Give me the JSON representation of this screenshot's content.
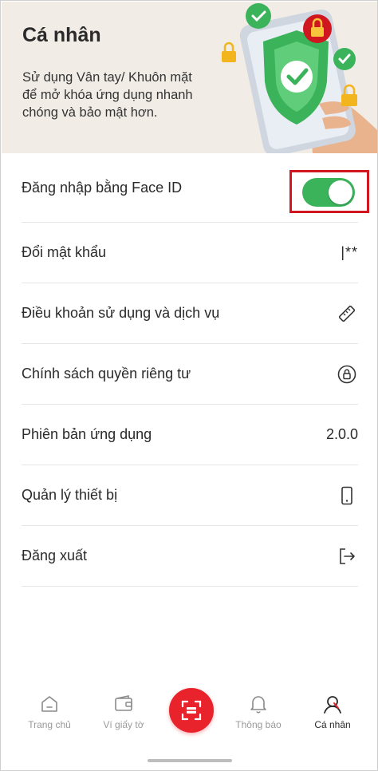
{
  "header": {
    "title": "Cá nhân",
    "subtitle": "Sử dụng Vân tay/ Khuôn mặt\nđể mở  khóa ứng dụng nhanh\nchóng và bảo mật hơn."
  },
  "settings": [
    {
      "label": "Đăng nhập bằng Face ID",
      "type": "toggle",
      "enabled": true
    },
    {
      "label": "Đổi mật khẩu",
      "type": "password-icon",
      "icon": "password-icon",
      "icon_text": "|**"
    },
    {
      "label": "Điều khoản sử dụng và dịch vụ",
      "type": "icon",
      "icon": "ruler-icon"
    },
    {
      "label": "Chính sách quyền riêng tư",
      "type": "icon",
      "icon": "privacy-lock-icon"
    },
    {
      "label": "Phiên bản ứng dụng",
      "type": "value",
      "value": "2.0.0"
    },
    {
      "label": "Quản lý thiết bị",
      "type": "icon",
      "icon": "phone-icon"
    },
    {
      "label": "Đăng xuất",
      "type": "icon",
      "icon": "logout-icon"
    }
  ],
  "bottom_nav": {
    "items": [
      {
        "label": "Trang chủ",
        "icon": "home-icon",
        "active": false
      },
      {
        "label": "Ví giấy tờ",
        "icon": "wallet-icon",
        "active": false
      },
      {
        "label": "Thông báo",
        "icon": "bell-icon",
        "active": false
      },
      {
        "label": "Cá nhân",
        "icon": "profile-icon",
        "active": true
      }
    ],
    "scan_icon": "scan-icon"
  },
  "colors": {
    "header_bg": "#f1ece6",
    "toggle_on": "#3bb35b",
    "accent_red": "#e8232b",
    "highlight_border": "#d0161e"
  }
}
